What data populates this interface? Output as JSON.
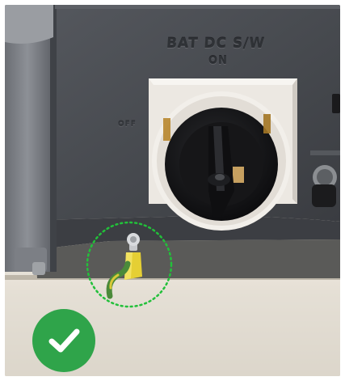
{
  "photo": {
    "switch_label": "BAT DC S/W",
    "switch_on_label": "ON",
    "switch_off_label": "OFF"
  },
  "status_icon": "checkmark-icon",
  "colors": {
    "check_badge": "#2fa44a",
    "highlight_circle": "#22c03a",
    "panel": "#45484d",
    "wall": "#e3ddd2"
  }
}
